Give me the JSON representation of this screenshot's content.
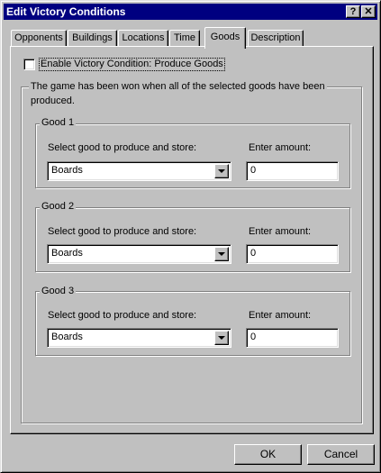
{
  "window": {
    "title": "Edit Victory Conditions",
    "help_label": "?",
    "close_label": "✕"
  },
  "tabs": [
    {
      "label": "Opponents"
    },
    {
      "label": "Buildings"
    },
    {
      "label": "Locations"
    },
    {
      "label": "Time"
    },
    {
      "label": "Goods",
      "active": true
    },
    {
      "label": "Description"
    }
  ],
  "goods_tab": {
    "enable_label": "Enable Victory Condition: Produce Goods",
    "enable_checked": false,
    "description_line1": "The game has been won when all of the selected goods have been",
    "description_line2": "produced.",
    "goods": [
      {
        "caption": "Good 1",
        "select_label": "Select good to produce and store:",
        "amount_label": "Enter amount:",
        "selected_good": "Boards",
        "amount": "0"
      },
      {
        "caption": "Good 2",
        "select_label": "Select good to produce and store:",
        "amount_label": "Enter amount:",
        "selected_good": "Boards",
        "amount": "0"
      },
      {
        "caption": "Good 3",
        "select_label": "Select good to produce and store:",
        "amount_label": "Enter amount:",
        "selected_good": "Boards",
        "amount": "0"
      }
    ]
  },
  "buttons": {
    "ok": "OK",
    "cancel": "Cancel"
  }
}
